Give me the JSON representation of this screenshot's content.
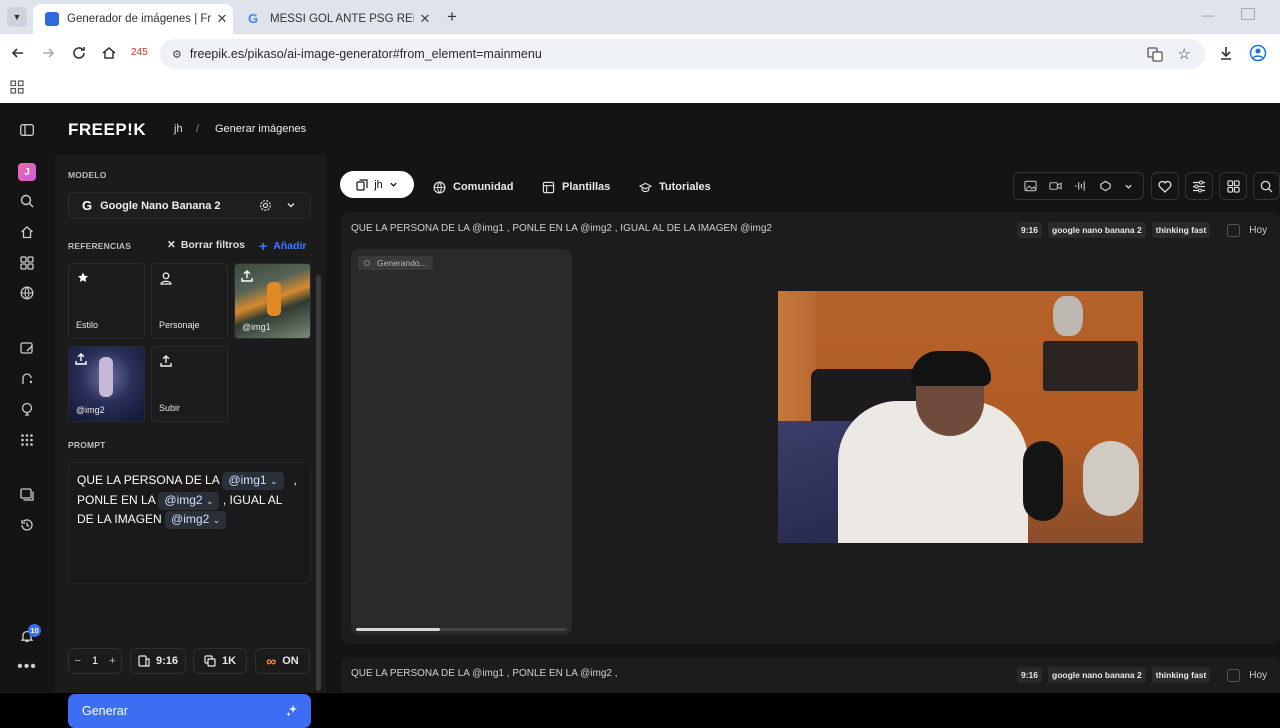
{
  "browser": {
    "tabs": [
      {
        "title": "Generador de imágenes | Freep",
        "favicon_color": "#2f6ae1"
      },
      {
        "title": "MESSI GOL ANTE PSG REMONT",
        "favicon_color": "#4285f4"
      }
    ],
    "url": "freepik.es/pikaso/ai-image-generator#from_element=mainmenu",
    "badge": "245"
  },
  "app": {
    "logo": "FREEP!K",
    "breadcrumb_user": "jh",
    "breadcrumb_sep": "/",
    "breadcrumb_page": "Generar imágenes",
    "rail_avatar": "J",
    "notifications_count": "10",
    "accent": "#3d6df2"
  },
  "panel": {
    "model_label": "MODELO",
    "model_name": "Google Nano Banana 2",
    "references_label": "REFERENCIAS",
    "clear_filters": "Borrar filtros",
    "add": "Añadir",
    "tiles": [
      {
        "label": "Estilo",
        "icon": "style-icon"
      },
      {
        "label": "Personaje",
        "icon": "person-icon"
      },
      {
        "label": "@img1",
        "icon": "upload-icon"
      },
      {
        "label": "@img2",
        "icon": "upload-icon"
      },
      {
        "label": "Subir",
        "icon": "upload-icon"
      }
    ],
    "prompt_label": "PROMPT",
    "prompt": {
      "t1": "QUE LA PERSONA DE LA",
      "chip1": "@img1",
      "t2": ",",
      "t3": "PONLE EN LA",
      "chip2": "@img2",
      "t4": ", IGUAL AL",
      "t5": "DE LA IMAGEN",
      "chip3": "@img2"
    },
    "controls": {
      "minus": "−",
      "count": "1",
      "plus": "+",
      "ratio": "9:16",
      "resolution": "1K",
      "infinite": "ON"
    },
    "generate": "Generar"
  },
  "main": {
    "workspace": "jh",
    "nav": [
      "Comunidad",
      "Plantillas",
      "Tutoriales"
    ],
    "card1": {
      "prompt": "QUE LA PERSONA DE LA @img1 , PONLE EN LA @img2 , IGUAL AL DE LA IMAGEN @img2",
      "tags": [
        "9:16",
        "google nano banana 2",
        "thinking fast"
      ],
      "date": "Hoy",
      "status": "Generando...",
      "progress": 0.4
    },
    "card2": {
      "prompt": "QUE LA PERSONA DE LA @img1 , PONLE EN LA @img2 ,",
      "tags": [
        "9:16",
        "google nano banana 2",
        "thinking fast"
      ],
      "date": "Hoy"
    }
  }
}
